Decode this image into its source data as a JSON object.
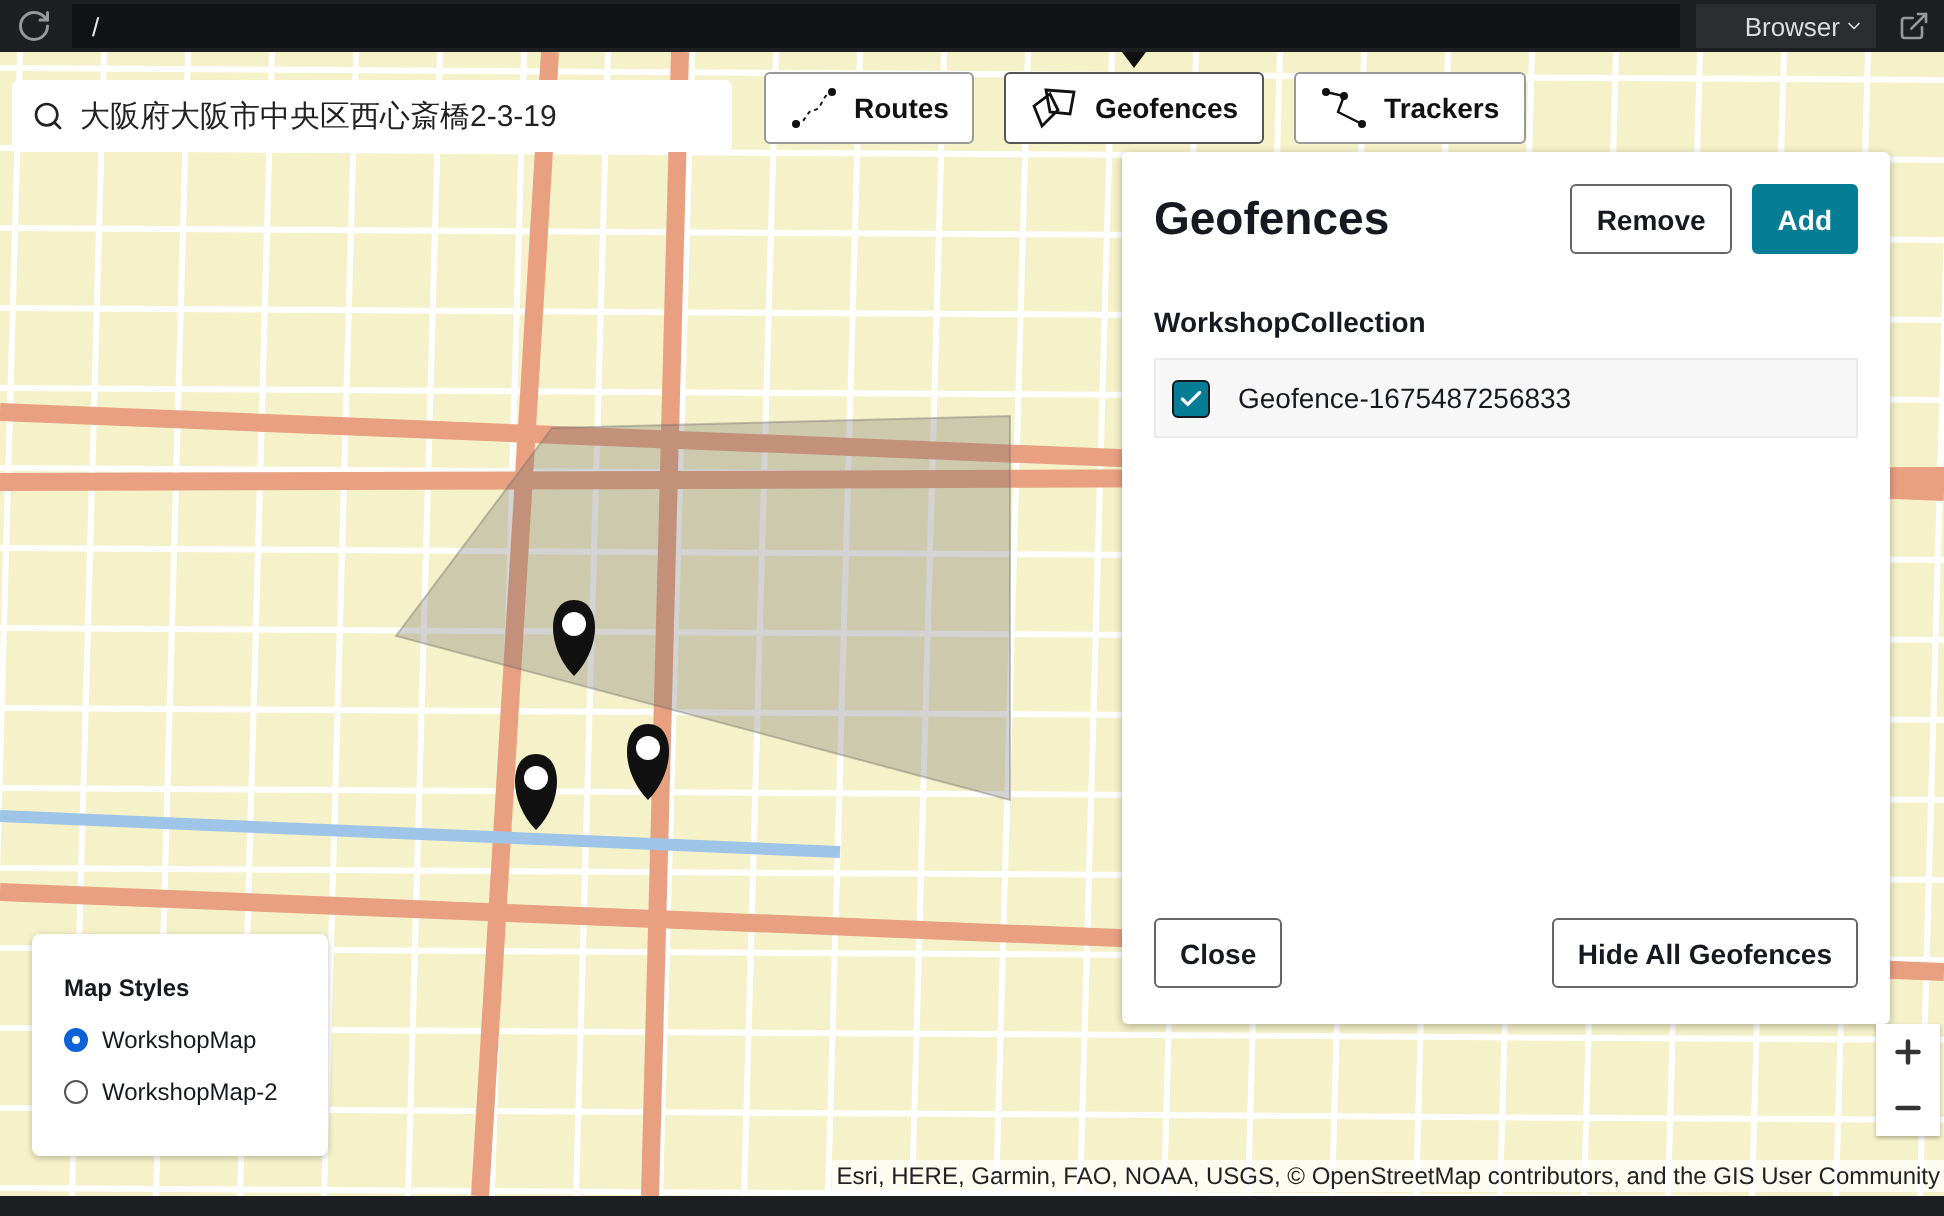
{
  "top_bar": {
    "path": "/",
    "browser_button": "Browser"
  },
  "search": {
    "value": "大阪府大阪市中央区西心斎橋2-3-19"
  },
  "tabs": [
    {
      "label": "Routes",
      "kind": "routes",
      "selected": false
    },
    {
      "label": "Geofences",
      "kind": "geofences",
      "selected": true
    },
    {
      "label": "Trackers",
      "kind": "trackers",
      "selected": false
    }
  ],
  "panel": {
    "title": "Geofences",
    "buttons": [
      {
        "label": "Remove",
        "kind": "secondary"
      },
      {
        "label": "Add",
        "kind": "primary"
      }
    ],
    "collection": "WorkshopCollection",
    "geofences": [
      {
        "name": "Geofence-1675487256833",
        "checked": true
      }
    ],
    "footer_buttons": [
      "Close",
      "Hide All Geofences"
    ]
  },
  "map_styles": {
    "title": "Map Styles",
    "options": [
      {
        "label": "WorkshopMap",
        "selected": true
      },
      {
        "label": "WorkshopMap-2",
        "selected": false
      }
    ]
  },
  "attribution": "Esri, HERE, Garmin, FAO, NOAA, USGS, © OpenStreetMap contributors, and the GIS User Community"
}
